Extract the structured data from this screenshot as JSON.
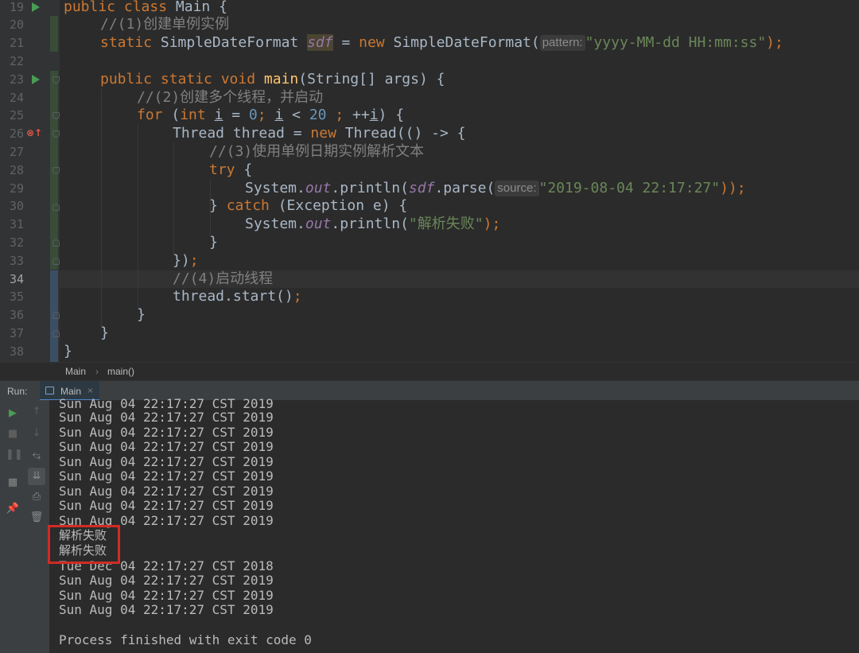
{
  "editor": {
    "line_numbers": [
      "19",
      "20",
      "21",
      "22",
      "23",
      "24",
      "25",
      "26",
      "27",
      "28",
      "29",
      "30",
      "31",
      "32",
      "33",
      "34",
      "35",
      "36",
      "37",
      "38"
    ],
    "current_line": "34",
    "code": {
      "l19": {
        "kw1": "public class ",
        "name": "Main {"
      },
      "l20": {
        "comment": "//(1)创建单例实例"
      },
      "l21": {
        "kw1": "static ",
        "type": "SimpleDateFormat ",
        "var": "sdf",
        "eq": " = ",
        "kw2": "new ",
        "call": "SimpleDateFormat(",
        "hint": "pattern:",
        "str": "\"yyyy-MM-dd HH:mm:ss\"",
        "end": ");"
      },
      "l23": {
        "kw1": "public static void ",
        "fn": "main",
        "rest": "(String[] args) {"
      },
      "l24": {
        "comment": "//(2)创建多个线程，并启动"
      },
      "l25": {
        "kw1": "for ",
        "p1": "(",
        "kw2": "int ",
        "i1": "i",
        "p2": " = ",
        "n1": "0",
        "semi1": "; ",
        "i2": "i",
        "p3": " < ",
        "n2": "20",
        "semi2": " ; ",
        "p4": "++",
        "i3": "i",
        "p5": ") {"
      },
      "l26": {
        "a": "Thread thread = ",
        "kw": "new ",
        "b": "Thread(() -> {"
      },
      "l27": {
        "comment": "//(3)使用单例日期实例解析文本"
      },
      "l28": {
        "kw": "try ",
        "b": "{"
      },
      "l29": {
        "a": "System.",
        "out": "out",
        "b": ".println(",
        "var": "sdf",
        "c": ".parse(",
        "hint": "source:",
        "str": "\"2019-08-04 22:17:27\"",
        "end": "));"
      },
      "l30": {
        "a": "} ",
        "kw": "catch ",
        "b": "(Exception e) {"
      },
      "l31": {
        "a": "System.",
        "out": "out",
        "b": ".println(",
        "str": "\"解析失败\"",
        "end": ");"
      },
      "l32": {
        "a": "}"
      },
      "l33": {
        "a": "})",
        "semi": ";"
      },
      "l34": {
        "comment": "//(4)启动线程"
      },
      "l35": {
        "a": "thread.start()",
        "semi": ";"
      },
      "l36": {
        "a": "}"
      },
      "l37": {
        "a": "}"
      },
      "l38": {
        "a": "}"
      }
    }
  },
  "breadcrumb": {
    "class": "Main",
    "sep": "›",
    "method": "main()"
  },
  "run_panel": {
    "label": "Run:",
    "tab": "Main",
    "close": "×"
  },
  "console": {
    "lines": [
      "Sun Aug 04 22:17:27 CST 2019",
      "Sun Aug 04 22:17:27 CST 2019",
      "Sun Aug 04 22:17:27 CST 2019",
      "Sun Aug 04 22:17:27 CST 2019",
      "Sun Aug 04 22:17:27 CST 2019",
      "Sun Aug 04 22:17:27 CST 2019",
      "Sun Aug 04 22:17:27 CST 2019",
      "Sun Aug 04 22:17:27 CST 2019",
      "Sun Aug 04 22:17:27 CST 2019",
      "解析失败",
      "解析失败",
      "",
      "Tue Dec 04 22:17:27 CST 2018",
      "Sun Aug 04 22:17:27 CST 2019",
      "Sun Aug 04 22:17:27 CST 2019",
      "Sun Aug 04 22:17:27 CST 2019",
      "",
      "Process finished with exit code 0"
    ]
  }
}
